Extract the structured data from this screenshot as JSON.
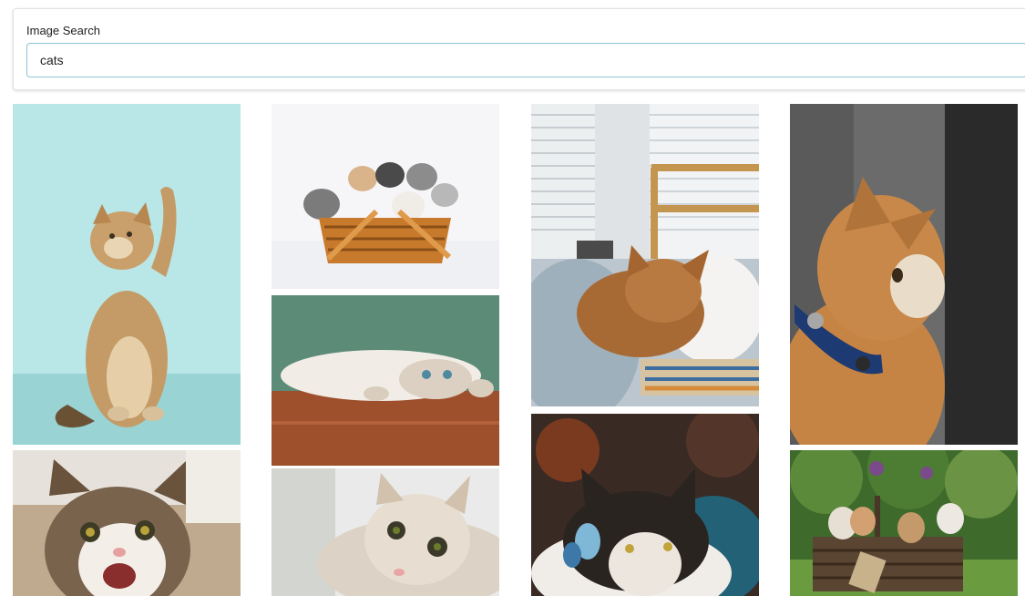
{
  "search": {
    "label": "Image Search",
    "value": "cats"
  },
  "gallery": {
    "images": [
      {
        "name": "cat-image-tabby-paw-raised-teal",
        "theme": "teal"
      },
      {
        "name": "cat-image-kittens-in-basket",
        "theme": "white"
      },
      {
        "name": "cat-image-sleeping-by-window",
        "theme": "window"
      },
      {
        "name": "cat-image-profile-blue-collar",
        "theme": "dark"
      },
      {
        "name": "cat-image-lying-upside-down",
        "theme": "floor"
      },
      {
        "name": "cat-image-meowing-indoor",
        "theme": "indoor"
      },
      {
        "name": "cat-image-surprised-white",
        "theme": "white2"
      },
      {
        "name": "cat-image-butterfly-on-nose",
        "theme": "bokeh"
      },
      {
        "name": "cat-image-kittens-garden-basket",
        "theme": "garden"
      }
    ]
  }
}
